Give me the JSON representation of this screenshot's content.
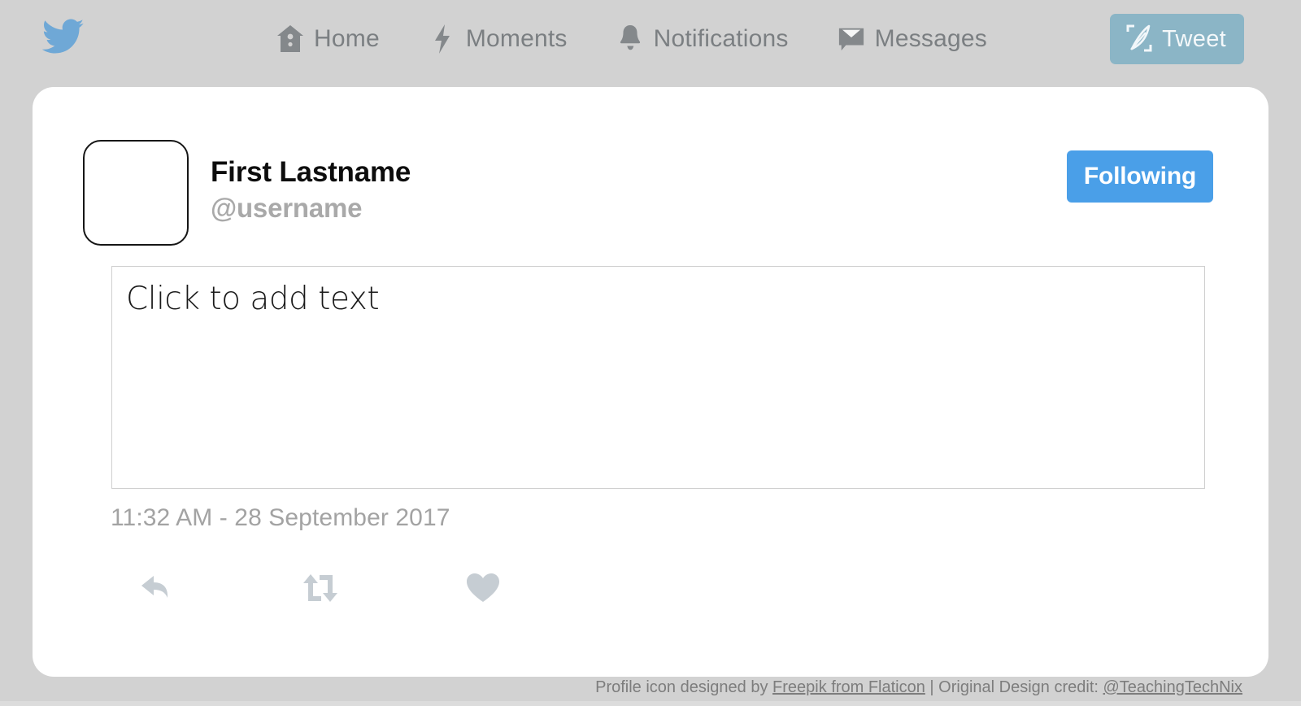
{
  "nav": {
    "logo_icon": "twitter-bird-icon",
    "items": [
      {
        "label": "Home",
        "icon": "home-icon"
      },
      {
        "label": "Moments",
        "icon": "lightning-bolt-icon"
      },
      {
        "label": "Notifications",
        "icon": "bell-icon"
      },
      {
        "label": "Messages",
        "icon": "envelope-icon"
      }
    ],
    "tweet_button": {
      "label": "Tweet",
      "icon": "quill-compose-icon",
      "color": "#8bb5c6"
    }
  },
  "tweet_card": {
    "avatar": {
      "icon": "avatar-placeholder",
      "alt": "empty profile picture placeholder"
    },
    "display_name": "First Lastname",
    "handle": "@username",
    "follow_button": {
      "label": "Following",
      "color": "#4a9fe8"
    },
    "body": {
      "placeholder": "Click to add text",
      "value": ""
    },
    "timestamp": "11:32 AM - 28 September 2017",
    "actions": [
      {
        "name": "reply",
        "icon": "reply-arrow-icon"
      },
      {
        "name": "retweet",
        "icon": "retweet-icon"
      },
      {
        "name": "like",
        "icon": "heart-icon"
      }
    ]
  },
  "footer": {
    "prefix": "Profile icon designed by ",
    "link1": "Freepik from Flaticon",
    "separator": " | Original Design credit: ",
    "link2": "@TeachingTechNix"
  },
  "colors": {
    "background": "#d2d2d2",
    "card": "#ffffff",
    "nav_text": "#7b7f82",
    "accent_blue": "#4a9fe8",
    "muted_blue": "#8bb5c6",
    "icon_gray": "#c6cdd3"
  }
}
